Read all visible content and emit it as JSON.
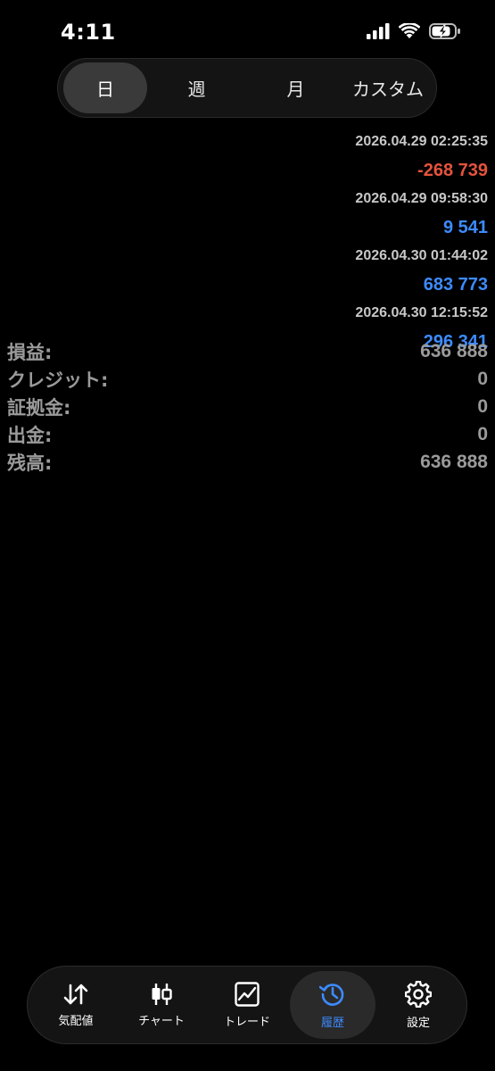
{
  "status_bar": {
    "time": "4:11"
  },
  "period_tabs": [
    {
      "label": "日",
      "active": true
    },
    {
      "label": "週",
      "active": false
    },
    {
      "label": "月",
      "active": false
    },
    {
      "label": "カスタム",
      "active": false
    }
  ],
  "deals": [
    {
      "time": "2026.04.29 02:25:35",
      "profit": "-268 739",
      "color": "#e5533d"
    },
    {
      "time": "2026.04.29 09:58:30",
      "profit": "9 541",
      "color": "#3d8bff"
    },
    {
      "time": "2026.04.30 01:44:02",
      "profit": "683 773",
      "color": "#3d8bff"
    },
    {
      "time": "2026.04.30 12:15:52",
      "profit": "296 341",
      "color": "#3d8bff"
    }
  ],
  "summary": [
    {
      "label": "損益:",
      "value": "636 888"
    },
    {
      "label": "クレジット:",
      "value": "0"
    },
    {
      "label": "証拠金:",
      "value": "0"
    },
    {
      "label": "出金:",
      "value": "0"
    },
    {
      "label": "残高:",
      "value": "636 888"
    }
  ],
  "tabbar": [
    {
      "label": "気配値",
      "icon": "quotes-arrows-icon",
      "active": false
    },
    {
      "label": "チャート",
      "icon": "candlestick-chart-icon",
      "active": false
    },
    {
      "label": "トレード",
      "icon": "trade-chart-icon",
      "active": false
    },
    {
      "label": "履歴",
      "icon": "history-clock-icon",
      "active": true
    },
    {
      "label": "設定",
      "icon": "gear-icon",
      "active": false
    }
  ],
  "colors": {
    "loss": "#e5533d",
    "profit": "#3d8bff",
    "accent": "#3d8bff"
  }
}
